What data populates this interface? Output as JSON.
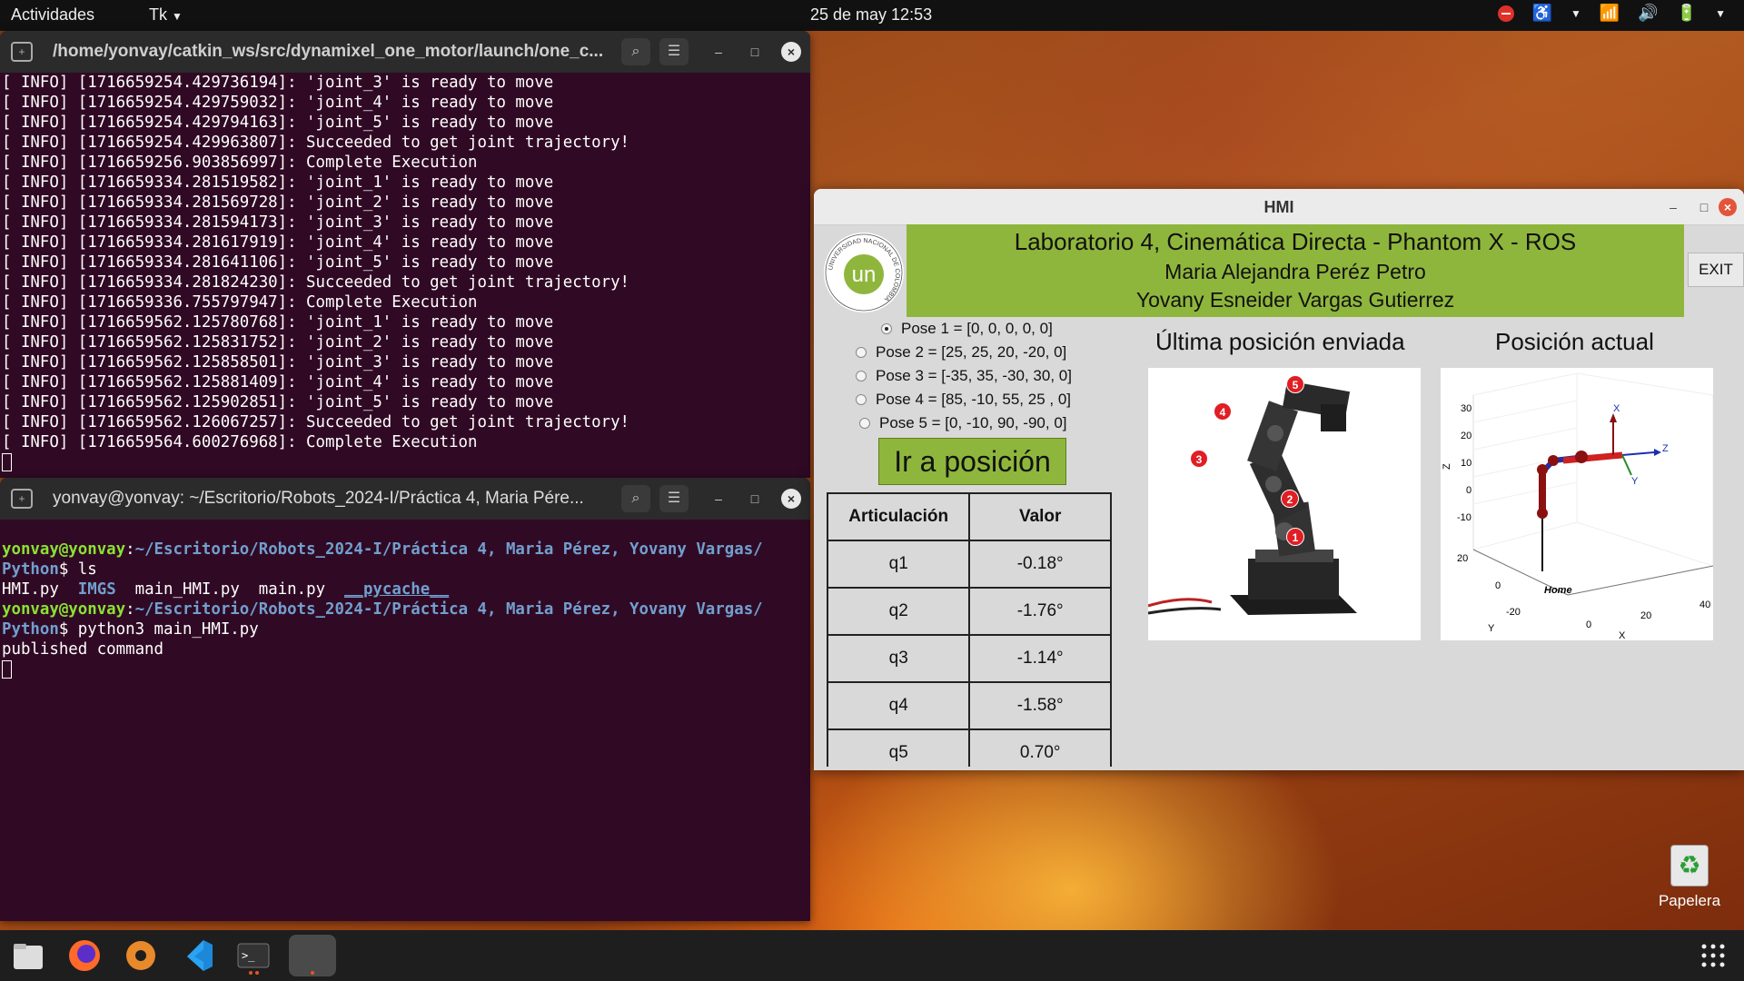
{
  "topbar": {
    "activities": "Actividades",
    "app_menu": "Tk",
    "clock": "25 de may  12:53"
  },
  "terminal1": {
    "title": "/home/yonvay/catkin_ws/src/dynamixel_one_motor/launch/one_c...",
    "lines": [
      "[ INFO] [1716659254.429736194]: 'joint_3' is ready to move",
      "[ INFO] [1716659254.429759032]: 'joint_4' is ready to move",
      "[ INFO] [1716659254.429794163]: 'joint_5' is ready to move",
      "[ INFO] [1716659254.429963807]: Succeeded to get joint trajectory!",
      "[ INFO] [1716659256.903856997]: Complete Execution",
      "[ INFO] [1716659334.281519582]: 'joint_1' is ready to move",
      "[ INFO] [1716659334.281569728]: 'joint_2' is ready to move",
      "[ INFO] [1716659334.281594173]: 'joint_3' is ready to move",
      "[ INFO] [1716659334.281617919]: 'joint_4' is ready to move",
      "[ INFO] [1716659334.281641106]: 'joint_5' is ready to move",
      "[ INFO] [1716659334.281824230]: Succeeded to get joint trajectory!",
      "[ INFO] [1716659336.755797947]: Complete Execution",
      "[ INFO] [1716659562.125780768]: 'joint_1' is ready to move",
      "[ INFO] [1716659562.125831752]: 'joint_2' is ready to move",
      "[ INFO] [1716659562.125858501]: 'joint_3' is ready to move",
      "[ INFO] [1716659562.125881409]: 'joint_4' is ready to move",
      "[ INFO] [1716659562.125902851]: 'joint_5' is ready to move",
      "[ INFO] [1716659562.126067257]: Succeeded to get joint trajectory!",
      "[ INFO] [1716659564.600276968]: Complete Execution"
    ]
  },
  "terminal2": {
    "title": "yonvay@yonvay: ~/Escritorio/Robots_2024-I/Práctica 4, Maria Pére...",
    "prompt_user": "yonvay@yonvay",
    "prompt_path_1": "~/Escritorio/Robots_2024-I/Práctica 4, Maria Pérez, Yovany Vargas/",
    "prompt_path_2": "Python",
    "cmd1": "ls",
    "ls_files": [
      "HMI.py",
      "IMGS",
      "main_HMI.py",
      "main.py",
      "__pycache__"
    ],
    "cmd2": "python3 main_HMI.py",
    "output": "published command"
  },
  "hmi": {
    "title": "HMI",
    "logo_text": "un",
    "logo_ring": "UNIVERSIDAD NACIONAL DE COLOMBIA",
    "banner_line1": "Laboratorio 4, Cinemática Directa - Phantom X - ROS",
    "banner_line2": "Maria Alejandra Peréz Petro",
    "banner_line3": "Yovany Esneider Vargas Gutierrez",
    "exit_label": "EXIT",
    "poses": [
      {
        "label": "Pose 1 = [0, 0, 0, 0, 0]",
        "selected": true
      },
      {
        "label": "Pose 2 = [25, 25, 20, -20, 0]",
        "selected": false
      },
      {
        "label": "Pose 3 = [-35, 35, -30, 30, 0]",
        "selected": false
      },
      {
        "label": "Pose 4 = [85, -10, 55, 25 , 0]",
        "selected": false
      },
      {
        "label": "Pose 5 = [0, -10, 90, -90, 0]",
        "selected": false
      }
    ],
    "go_label": "Ir a posición",
    "table_headers": [
      "Articulación",
      "Valor"
    ],
    "table_rows": [
      [
        "q1",
        "-0.18°"
      ],
      [
        "q2",
        "-1.76°"
      ],
      [
        "q3",
        "-1.14°"
      ],
      [
        "q4",
        "-1.58°"
      ],
      [
        "q5",
        "0.70°"
      ]
    ],
    "last_sent_title": "Última posición enviada",
    "current_title": "Posición actual",
    "robot_badges": [
      "1",
      "2",
      "3",
      "4",
      "5"
    ],
    "plot": {
      "z_label": "Z",
      "y_label": "Y",
      "x_label": "X",
      "z_ticks": [
        "30",
        "20",
        "10",
        "0",
        "-10"
      ],
      "y_ticks": [
        "20",
        "0",
        "-20"
      ],
      "x_ticks": [
        "0",
        "20",
        "40"
      ],
      "home_label": "Home",
      "frame_x": "X",
      "frame_y": "Y",
      "frame_z": "Z"
    }
  },
  "desktop": {
    "trash_label": "Papelera"
  }
}
